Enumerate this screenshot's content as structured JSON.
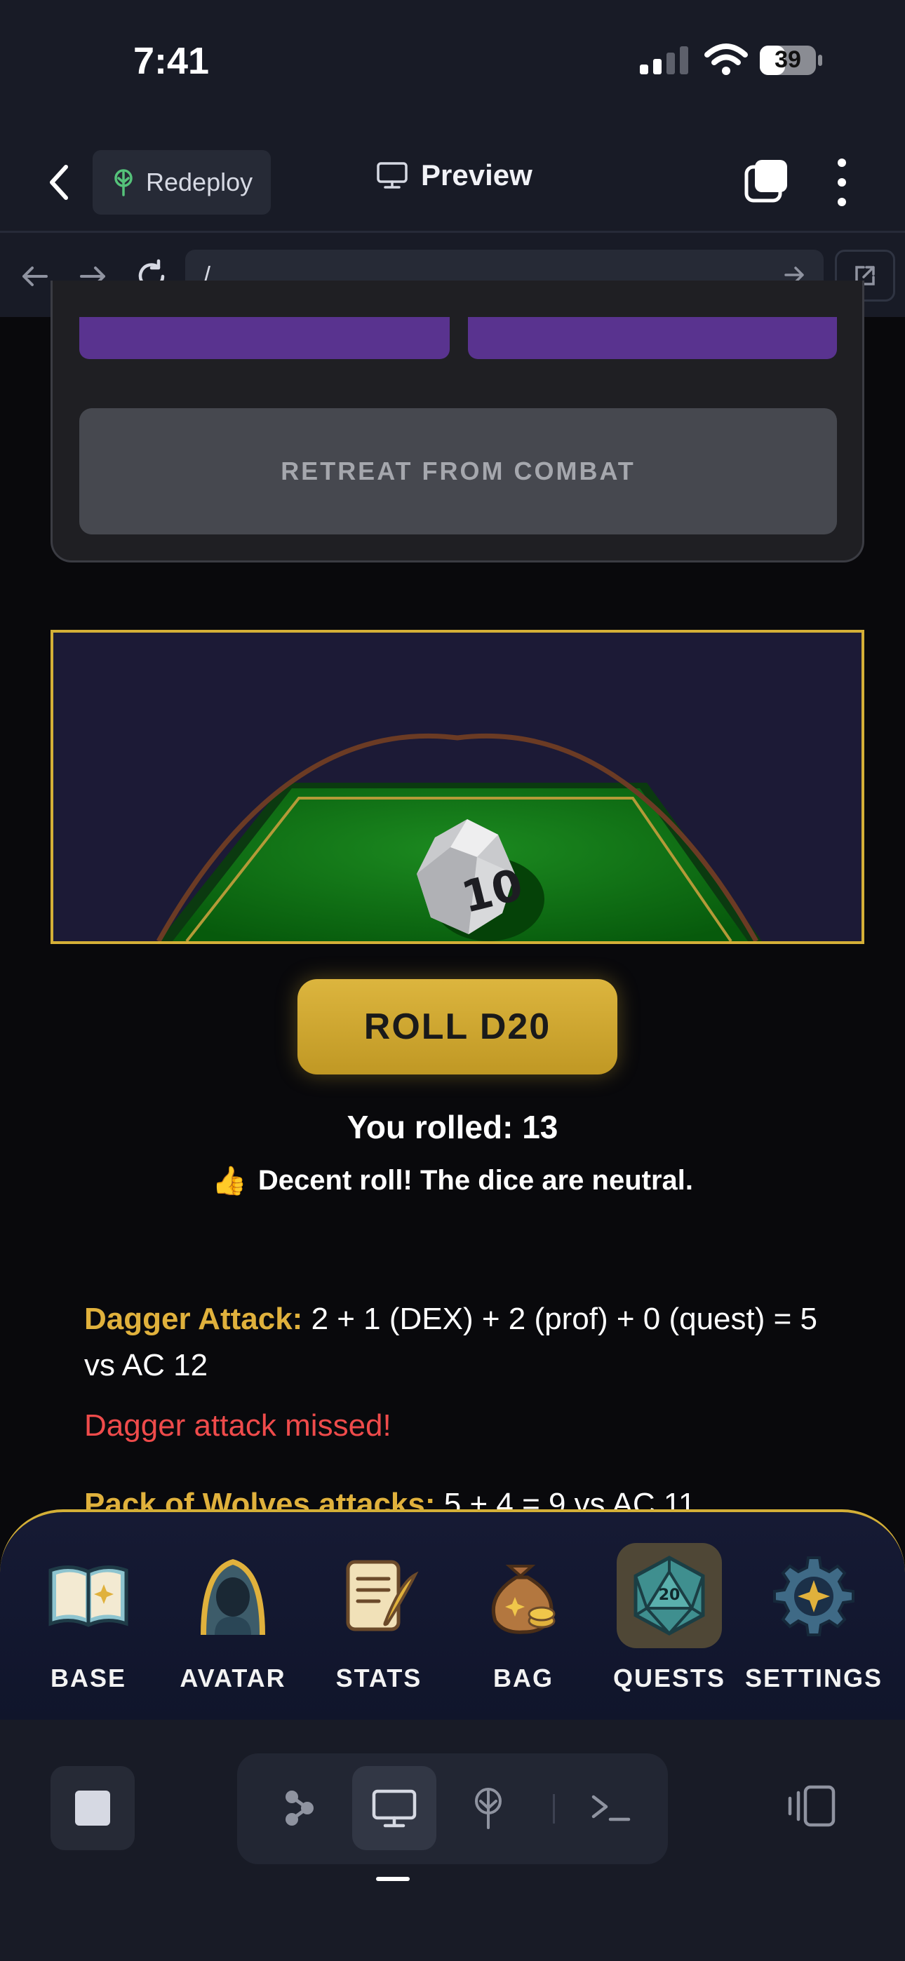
{
  "status_bar": {
    "time": "7:41",
    "battery": "39"
  },
  "header": {
    "redeploy_label": "Redeploy",
    "preview_label": "Preview"
  },
  "browser": {
    "url": "/"
  },
  "combat": {
    "retreat_label": "RETREAT FROM COMBAT"
  },
  "dice": {
    "roll_label": "ROLL D20",
    "face_value": "10"
  },
  "result": {
    "prefix": "You rolled:",
    "value": "13",
    "emoji": "👍",
    "comment": "Decent roll! The dice are neutral."
  },
  "log": [
    {
      "label": "Dagger Attack:",
      "text": " 2 + 1 (DEX) + 2 (prof) + 0 (quest) = 5 vs AC 12"
    },
    {
      "text": "Dagger attack missed!"
    },
    {
      "label": "Pack of Wolves attacks:",
      "text": " 5 + 4 = 9 vs AC 11"
    }
  ],
  "nav": [
    {
      "label": "BASE",
      "icon": "book-icon"
    },
    {
      "label": "AVATAR",
      "icon": "hooded-avatar-icon"
    },
    {
      "label": "STATS",
      "icon": "scroll-quill-icon"
    },
    {
      "label": "BAG",
      "icon": "money-bag-icon"
    },
    {
      "label": "QUESTS",
      "icon": "d20-icon",
      "active": true,
      "icon_text": "20"
    },
    {
      "label": "SETTINGS",
      "icon": "gear-icon"
    }
  ],
  "colors": {
    "accent_gold": "#d4af37",
    "danger_red": "#ef4b4b",
    "purple": "#59338f"
  }
}
